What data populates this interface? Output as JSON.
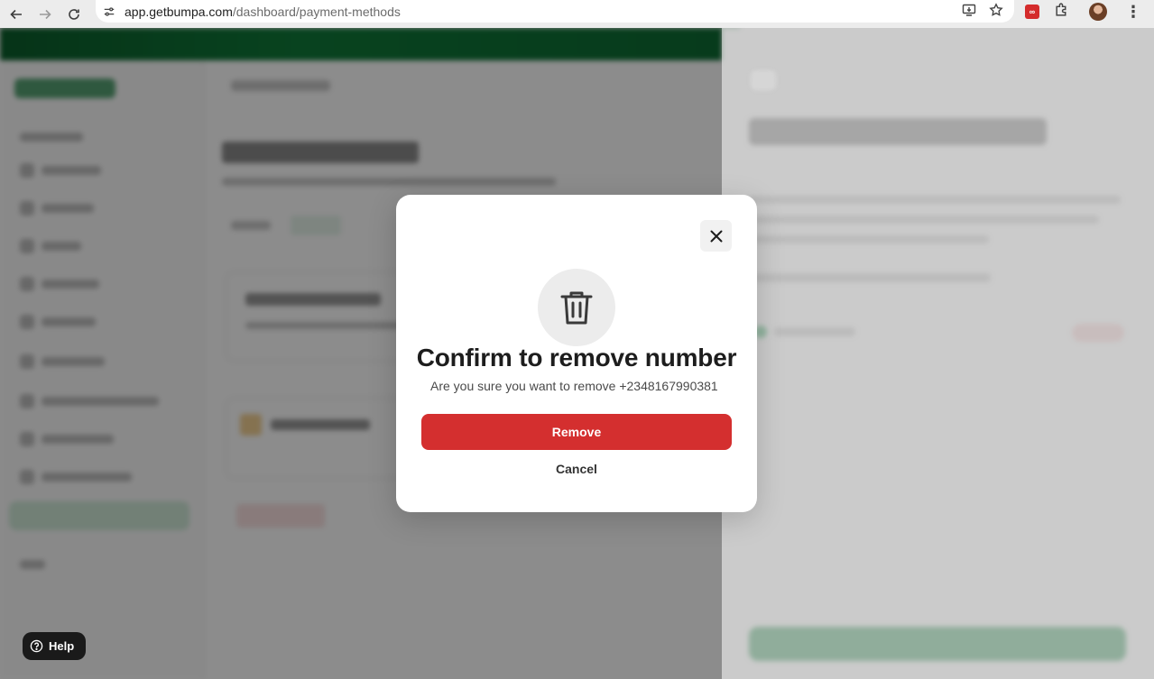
{
  "browser": {
    "url_domain": "app.getbumpa.com",
    "url_path": "/dashboard/payment-methods",
    "icons": [
      "back-arrow-icon",
      "forward-arrow-icon",
      "reload-icon",
      "site-settings-icon",
      "install-app-icon",
      "bookmark-star-icon",
      "extension-icon",
      "puzzle-icon",
      "profile-avatar",
      "more-menu-icon"
    ]
  },
  "modal": {
    "title": "Confirm to remove number",
    "description": "Are you sure you want to remove +2348167990381",
    "remove_label": "Remove",
    "cancel_label": "Cancel",
    "remove_color": "#d42f2f"
  },
  "help": {
    "label": "Help"
  },
  "colors": {
    "brand_green": "#0f7a39",
    "danger_red": "#d42f2f"
  }
}
